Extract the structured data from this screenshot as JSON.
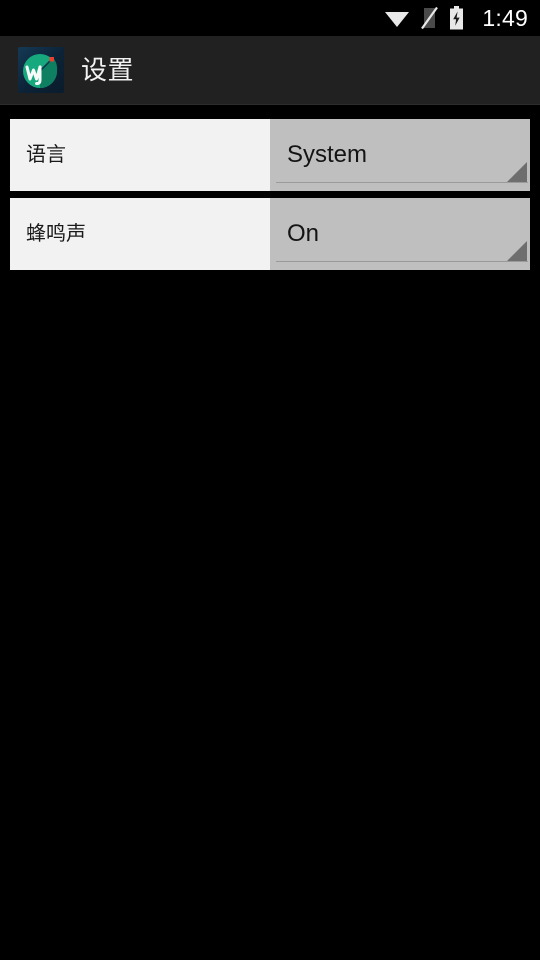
{
  "status_bar": {
    "time": "1:49",
    "icons": [
      {
        "name": "wifi-icon",
        "label": "wifi"
      },
      {
        "name": "no-sim-icon",
        "label": "no sim card"
      },
      {
        "name": "battery-charging-icon",
        "label": "battery charging"
      }
    ],
    "background_color": "#000000",
    "text_color": "#ffffff"
  },
  "action_bar": {
    "title": "设置",
    "icon_name": "app-logo-icon",
    "background_color": "#212121",
    "title_color": "#f2f2f2"
  },
  "settings": {
    "rows": [
      {
        "label": "语言",
        "value": "System",
        "control": "spinner"
      },
      {
        "label": "蜂鸣声",
        "value": "On",
        "control": "spinner"
      }
    ],
    "row_background": "#f2f2f2",
    "spinner_background": "#bfbfbf",
    "page_background": "#000000"
  }
}
